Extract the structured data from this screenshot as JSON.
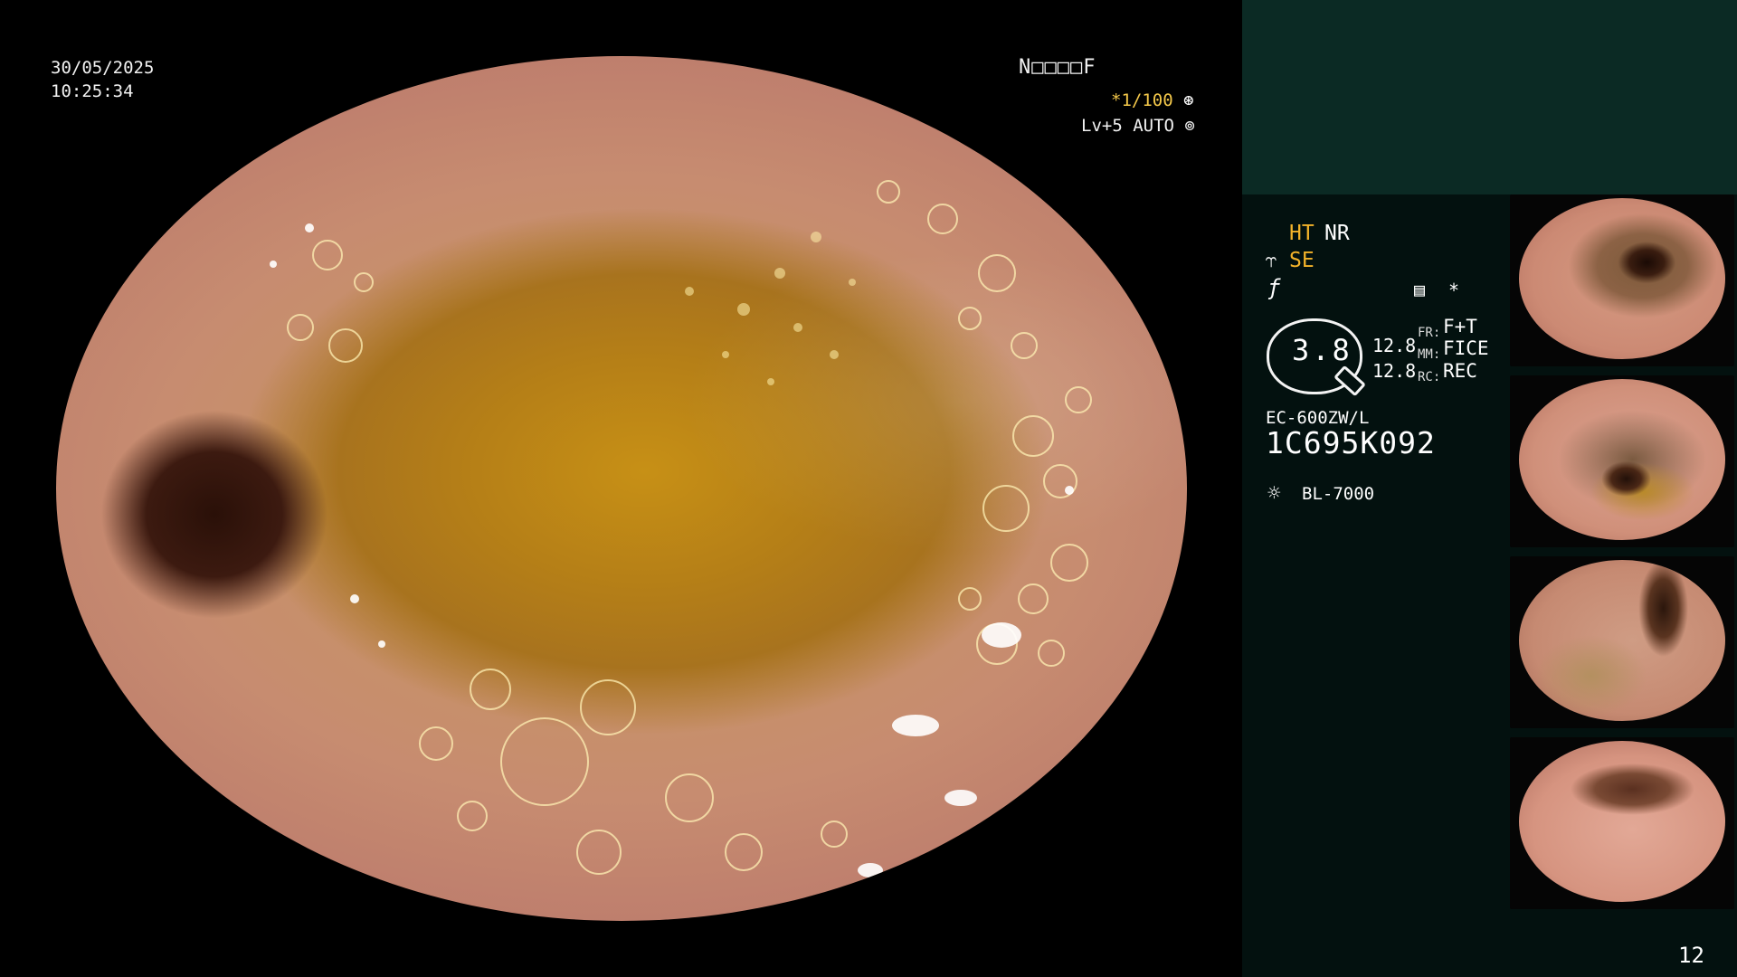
{
  "overlay": {
    "date": "30/05/2025",
    "time": "10:25:34",
    "status_code": "N□□□□F",
    "shutter": "*1/100",
    "shutter_icon": "aperture-icon",
    "level": "Lv+5 AUTO",
    "level_icon": "iris-icon"
  },
  "panel": {
    "ht": "HT",
    "nr": "NR",
    "se": "SE",
    "zoom": "3.8",
    "fr_value": "12.8",
    "mm_value": "12.8",
    "fr_label": "FR:",
    "mm_label": "MM:",
    "rc_label": "RC:",
    "fr_option": "F+T",
    "mm_option": "FICE",
    "rc_option": "REC",
    "scope_model": "EC-600ZW/L",
    "scope_serial": "1C695K092",
    "light_source": "BL-7000",
    "star": "*"
  },
  "icons": {
    "se": "structure-enhance-icon",
    "f": "f-mode-icon",
    "doc": "memo-icon",
    "light": "light-source-icon"
  },
  "thumbnails": [
    {
      "name": "thumbnail-1"
    },
    {
      "name": "thumbnail-2"
    },
    {
      "name": "thumbnail-3"
    },
    {
      "name": "thumbnail-4"
    }
  ],
  "page_number": "12",
  "colors": {
    "accent": "#f3b32a",
    "panel_bg": "#03110f",
    "panel_top": "#0b2a24"
  }
}
